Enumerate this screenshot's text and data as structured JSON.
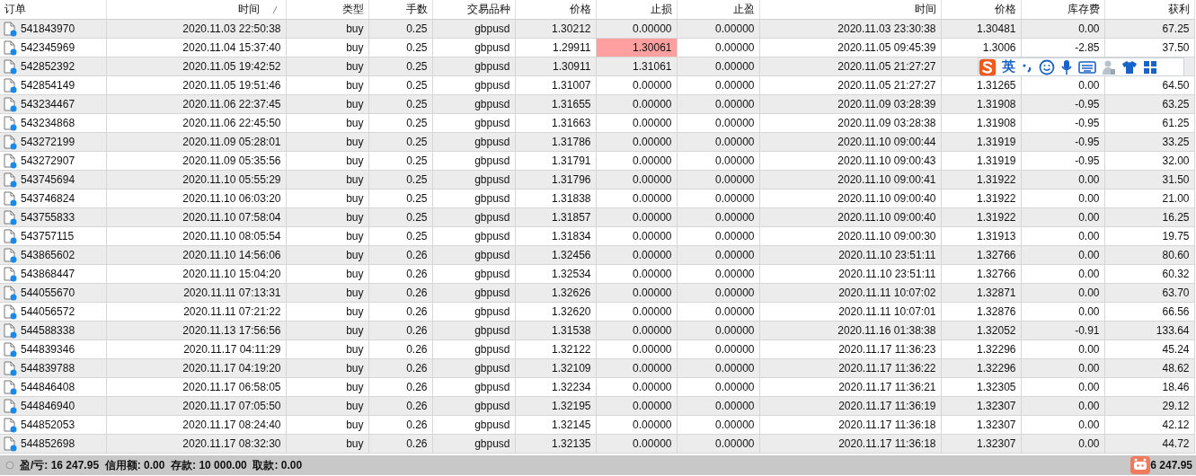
{
  "columns": [
    {
      "label": "订单",
      "sorted": false
    },
    {
      "label": "时间",
      "sorted": true
    },
    {
      "label": "类型",
      "sorted": false
    },
    {
      "label": "手数",
      "sorted": false
    },
    {
      "label": "交易品种",
      "sorted": false
    },
    {
      "label": "价格",
      "sorted": false
    },
    {
      "label": "止损",
      "sorted": false
    },
    {
      "label": "止盈",
      "sorted": false
    },
    {
      "label": "时间",
      "sorted": false
    },
    {
      "label": "价格",
      "sorted": false
    },
    {
      "label": "库存费",
      "sorted": false
    },
    {
      "label": "获利",
      "sorted": false
    }
  ],
  "rows": [
    {
      "cells": [
        "541843970",
        "2020.11.03 22:50:38",
        "buy",
        "0.25",
        "gbpusd",
        "1.30212",
        "0.00000",
        "0.00000",
        "2020.11.03 23:30:38",
        "1.30481",
        "0.00",
        "67.25"
      ],
      "sl_marked": false
    },
    {
      "cells": [
        "542345969",
        "2020.11.04 15:37:40",
        "buy",
        "0.25",
        "gbpusd",
        "1.29911",
        "1.30061",
        "0.00000",
        "2020.11.05 09:45:39",
        "1.3006",
        "-2.85",
        "37.50"
      ],
      "sl_marked": true
    },
    {
      "cells": [
        "542852392",
        "2020.11.05 19:42:52",
        "buy",
        "0.25",
        "gbpusd",
        "1.30911",
        "1.31061",
        "0.00000",
        "2020.11.05 21:27:27",
        null,
        null,
        null
      ],
      "sl_marked": false
    },
    {
      "cells": [
        "542854149",
        "2020.11.05 19:51:46",
        "buy",
        "0.25",
        "gbpusd",
        "1.31007",
        "0.00000",
        "0.00000",
        "2020.11.05 21:27:27",
        "1.31265",
        "0.00",
        "64.50"
      ],
      "sl_marked": false
    },
    {
      "cells": [
        "543234467",
        "2020.11.06 22:37:45",
        "buy",
        "0.25",
        "gbpusd",
        "1.31655",
        "0.00000",
        "0.00000",
        "2020.11.09 03:28:39",
        "1.31908",
        "-0.95",
        "63.25"
      ],
      "sl_marked": false
    },
    {
      "cells": [
        "543234868",
        "2020.11.06 22:45:50",
        "buy",
        "0.25",
        "gbpusd",
        "1.31663",
        "0.00000",
        "0.00000",
        "2020.11.09 03:28:38",
        "1.31908",
        "-0.95",
        "61.25"
      ],
      "sl_marked": false
    },
    {
      "cells": [
        "543272199",
        "2020.11.09 05:28:01",
        "buy",
        "0.25",
        "gbpusd",
        "1.31786",
        "0.00000",
        "0.00000",
        "2020.11.10 09:00:44",
        "1.31919",
        "-0.95",
        "33.25"
      ],
      "sl_marked": false
    },
    {
      "cells": [
        "543272907",
        "2020.11.09 05:35:56",
        "buy",
        "0.25",
        "gbpusd",
        "1.31791",
        "0.00000",
        "0.00000",
        "2020.11.10 09:00:43",
        "1.31919",
        "-0.95",
        "32.00"
      ],
      "sl_marked": false
    },
    {
      "cells": [
        "543745694",
        "2020.11.10 05:55:29",
        "buy",
        "0.25",
        "gbpusd",
        "1.31796",
        "0.00000",
        "0.00000",
        "2020.11.10 09:00:41",
        "1.31922",
        "0.00",
        "31.50"
      ],
      "sl_marked": false
    },
    {
      "cells": [
        "543746824",
        "2020.11.10 06:03:20",
        "buy",
        "0.25",
        "gbpusd",
        "1.31838",
        "0.00000",
        "0.00000",
        "2020.11.10 09:00:40",
        "1.31922",
        "0.00",
        "21.00"
      ],
      "sl_marked": false
    },
    {
      "cells": [
        "543755833",
        "2020.11.10 07:58:04",
        "buy",
        "0.25",
        "gbpusd",
        "1.31857",
        "0.00000",
        "0.00000",
        "2020.11.10 09:00:40",
        "1.31922",
        "0.00",
        "16.25"
      ],
      "sl_marked": false
    },
    {
      "cells": [
        "543757115",
        "2020.11.10 08:05:54",
        "buy",
        "0.25",
        "gbpusd",
        "1.31834",
        "0.00000",
        "0.00000",
        "2020.11.10 09:00:30",
        "1.31913",
        "0.00",
        "19.75"
      ],
      "sl_marked": false
    },
    {
      "cells": [
        "543865602",
        "2020.11.10 14:56:06",
        "buy",
        "0.26",
        "gbpusd",
        "1.32456",
        "0.00000",
        "0.00000",
        "2020.11.10 23:51:11",
        "1.32766",
        "0.00",
        "80.60"
      ],
      "sl_marked": false
    },
    {
      "cells": [
        "543868447",
        "2020.11.10 15:04:20",
        "buy",
        "0.26",
        "gbpusd",
        "1.32534",
        "0.00000",
        "0.00000",
        "2020.11.10 23:51:11",
        "1.32766",
        "0.00",
        "60.32"
      ],
      "sl_marked": false
    },
    {
      "cells": [
        "544055670",
        "2020.11.11 07:13:31",
        "buy",
        "0.26",
        "gbpusd",
        "1.32626",
        "0.00000",
        "0.00000",
        "2020.11.11 10:07:02",
        "1.32871",
        "0.00",
        "63.70"
      ],
      "sl_marked": false
    },
    {
      "cells": [
        "544056572",
        "2020.11.11 07:21:22",
        "buy",
        "0.26",
        "gbpusd",
        "1.32620",
        "0.00000",
        "0.00000",
        "2020.11.11 10:07:01",
        "1.32876",
        "0.00",
        "66.56"
      ],
      "sl_marked": false
    },
    {
      "cells": [
        "544588338",
        "2020.11.13 17:56:56",
        "buy",
        "0.26",
        "gbpusd",
        "1.31538",
        "0.00000",
        "0.00000",
        "2020.11.16 01:38:38",
        "1.32052",
        "-0.91",
        "133.64"
      ],
      "sl_marked": false
    },
    {
      "cells": [
        "544839346",
        "2020.11.17 04:11:29",
        "buy",
        "0.26",
        "gbpusd",
        "1.32122",
        "0.00000",
        "0.00000",
        "2020.11.17 11:36:23",
        "1.32296",
        "0.00",
        "45.24"
      ],
      "sl_marked": false
    },
    {
      "cells": [
        "544839788",
        "2020.11.17 04:19:20",
        "buy",
        "0.26",
        "gbpusd",
        "1.32109",
        "0.00000",
        "0.00000",
        "2020.11.17 11:36:22",
        "1.32296",
        "0.00",
        "48.62"
      ],
      "sl_marked": false
    },
    {
      "cells": [
        "544846408",
        "2020.11.17 06:58:05",
        "buy",
        "0.26",
        "gbpusd",
        "1.32234",
        "0.00000",
        "0.00000",
        "2020.11.17 11:36:21",
        "1.32305",
        "0.00",
        "18.46"
      ],
      "sl_marked": false
    },
    {
      "cells": [
        "544846940",
        "2020.11.17 07:05:50",
        "buy",
        "0.26",
        "gbpusd",
        "1.32195",
        "0.00000",
        "0.00000",
        "2020.11.17 11:36:19",
        "1.32307",
        "0.00",
        "29.12"
      ],
      "sl_marked": false
    },
    {
      "cells": [
        "544852053",
        "2020.11.17 08:24:40",
        "buy",
        "0.26",
        "gbpusd",
        "1.32145",
        "0.00000",
        "0.00000",
        "2020.11.17 11:36:18",
        "1.32307",
        "0.00",
        "42.12"
      ],
      "sl_marked": false
    },
    {
      "cells": [
        "544852698",
        "2020.11.17 08:32:30",
        "buy",
        "0.26",
        "gbpusd",
        "1.32135",
        "0.00000",
        "0.00000",
        "2020.11.17 11:36:18",
        "1.32307",
        "0.00",
        "44.72"
      ],
      "sl_marked": false
    }
  ],
  "ime_toolbar": {
    "language": "英"
  },
  "status_bar": {
    "summary": "盈/亏: 16 247.95  信用额: 0.00  存款: 10 000.00  取款: 0.00",
    "total": "6 247.95"
  }
}
